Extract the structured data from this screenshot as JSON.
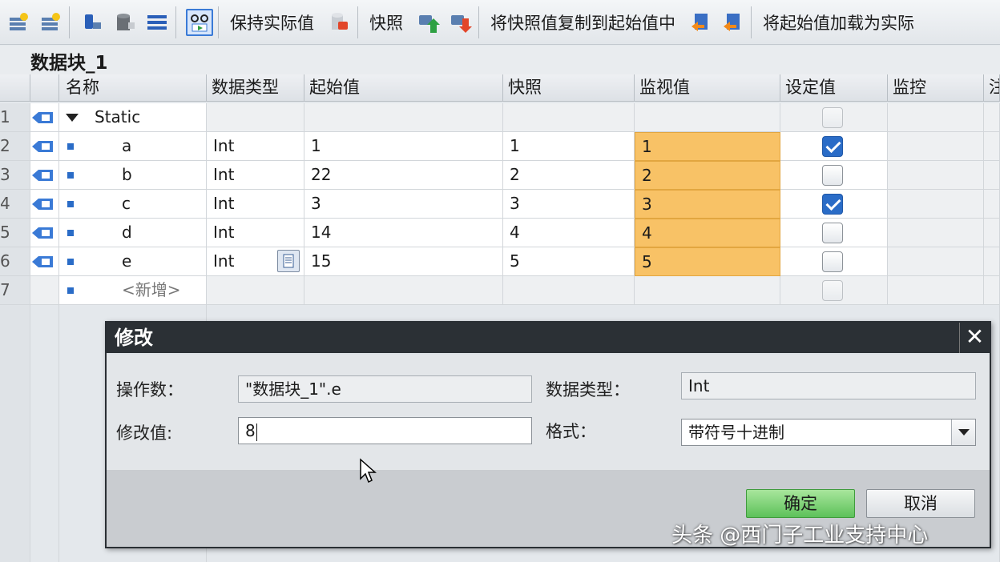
{
  "toolbar": {
    "icons": [
      "insert-row-icon",
      "add-row-icon",
      "expanded-mode-icon",
      "database-icon",
      "list-view-icon",
      "monitor-icon"
    ],
    "keep_actual_label": "保持实际值",
    "snapshot_label": "快照",
    "copy_snapshot_label": "将快照值复制到起始值中",
    "load_start_label": "将起始值加载为实际"
  },
  "block_title": "数据块_1",
  "columns": {
    "name": "名称",
    "datatype": "数据类型",
    "start": "起始值",
    "snapshot": "快照",
    "monitor": "监视值",
    "setpoint": "设定值",
    "supervision": "监控",
    "comment": "注"
  },
  "rows": [
    {
      "num": "1",
      "name": "Static",
      "type": "",
      "start": "",
      "snap": "",
      "mon": "",
      "set": false
    },
    {
      "num": "2",
      "name": "a",
      "type": "Int",
      "start": "1",
      "snap": "1",
      "mon": "1",
      "set": true
    },
    {
      "num": "3",
      "name": "b",
      "type": "Int",
      "start": "22",
      "snap": "2",
      "mon": "2",
      "set": false
    },
    {
      "num": "4",
      "name": "c",
      "type": "Int",
      "start": "3",
      "snap": "3",
      "mon": "3",
      "set": true
    },
    {
      "num": "5",
      "name": "d",
      "type": "Int",
      "start": "14",
      "snap": "4",
      "mon": "4",
      "set": false
    },
    {
      "num": "6",
      "name": "e",
      "type": "Int",
      "start": "15",
      "snap": "5",
      "mon": "5",
      "set": false
    },
    {
      "num": "7",
      "name": "<新增>",
      "type": "",
      "start": "",
      "snap": "",
      "mon": "",
      "set": false
    }
  ],
  "dialog": {
    "title": "修改",
    "close": "✕",
    "operand_label": "操作数：",
    "operand_value": "\"数据块_1\".e",
    "datatype_label": "数据类型：",
    "datatype_value": "Int",
    "modify_label": "修改值:",
    "modify_value": "8",
    "format_label": "格式：",
    "format_value": "带符号十进制",
    "ok_label": "确定",
    "cancel_label": "取消"
  },
  "watermark": "头条 @西门子工业支持中心",
  "colors": {
    "monitor_bg": "#f8c266",
    "accent": "#2a6cc7",
    "ok_button": "#5dc15a",
    "dialog_title": "#2b3035"
  }
}
